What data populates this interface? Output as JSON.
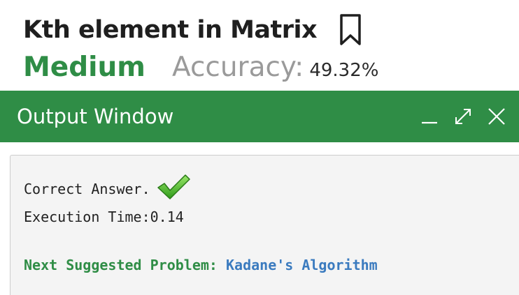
{
  "problem": {
    "title": "Kth element in Matrix",
    "difficulty": "Medium",
    "accuracy_label": "Accuracy:",
    "accuracy_value": "49.32%"
  },
  "output_window": {
    "title": "Output Window",
    "controls": [
      "minimize-icon",
      "expand-icon",
      "close-icon"
    ],
    "result_text": "Correct Answer.",
    "execution_time": "Execution Time:0.14",
    "next_label": "Next Suggested Problem:",
    "next_problem": "Kadane's Algorithm"
  },
  "colors": {
    "accent_green": "#2f8d46",
    "link_blue": "#3b7bbf",
    "muted_gray": "#9a9a9a"
  }
}
